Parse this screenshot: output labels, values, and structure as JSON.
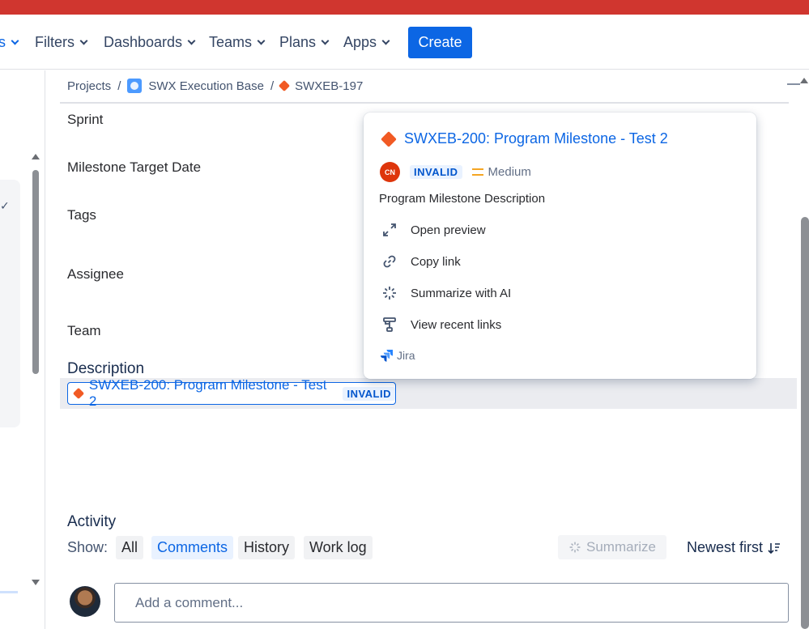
{
  "nav": {
    "items": [
      "s",
      "Filters",
      "Dashboards",
      "Teams",
      "Plans",
      "Apps"
    ],
    "create_label": "Create"
  },
  "breadcrumb": {
    "root": "Projects",
    "project": "SWX Execution Base",
    "issue": "SWXEB-197",
    "separator": "/"
  },
  "fields": [
    "Sprint",
    "Milestone Target Date",
    "Tags",
    "Assignee",
    "Team"
  ],
  "description": {
    "title": "Description",
    "link_text": "SWXEB-200: Program Milestone - Test 2",
    "link_status": "INVALID"
  },
  "hover_card": {
    "title": "SWXEB-200: Program Milestone - Test 2",
    "assignee_initials": "CN",
    "status": "INVALID",
    "priority": "Medium",
    "description": "Program Milestone Description",
    "actions": [
      {
        "label": "Open preview",
        "icon": "expand-icon"
      },
      {
        "label": "Copy link",
        "icon": "link-icon"
      },
      {
        "label": "Summarize with AI",
        "icon": "ai-sparkle-icon"
      },
      {
        "label": "View recent links",
        "icon": "hierarchy-icon"
      }
    ],
    "footer": "Jira"
  },
  "activity": {
    "title": "Activity",
    "show_label": "Show:",
    "filters": [
      "All",
      "Comments",
      "History",
      "Work log"
    ],
    "active_filter": "Comments",
    "summarize_label": "Summarize",
    "sort_label": "Newest first",
    "comment_placeholder": "Add a comment..."
  },
  "colors": {
    "accent": "#0c66e4",
    "topbar": "#d0362f",
    "issue_type": "#f15a24",
    "priority_medium": "#f5a623"
  }
}
